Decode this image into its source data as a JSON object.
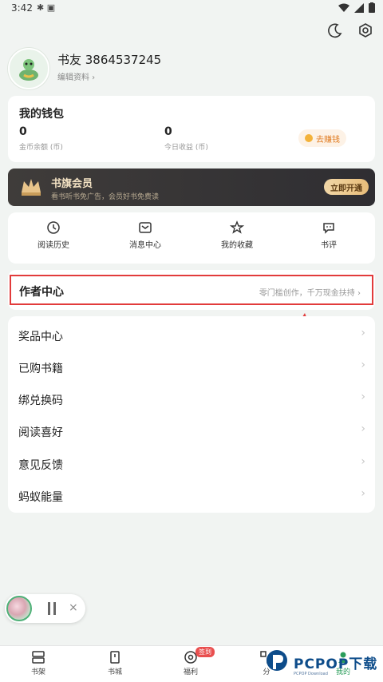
{
  "status_bar": {
    "time": "3:42"
  },
  "profile": {
    "username": "书友 3864537245",
    "edit_label": "编辑资料 ›"
  },
  "wallet": {
    "title": "我的钱包",
    "coin_balance": "0",
    "coin_label": "金币余额 (币)",
    "today_income": "0",
    "today_label": "今日收益 (币)",
    "earn_button": "去赚钱"
  },
  "vip": {
    "title": "书旗会员",
    "subtitle": "看书听书免广告，会员好书免费读",
    "button": "立即开通"
  },
  "quick_actions": [
    {
      "label": "阅读历史",
      "icon": "clock-icon"
    },
    {
      "label": "消息中心",
      "icon": "message-box-icon"
    },
    {
      "label": "我的收藏",
      "icon": "star-icon"
    },
    {
      "label": "书评",
      "icon": "chat-bubble-icon"
    }
  ],
  "author_center": {
    "title": "作者中心",
    "subtitle": "零门槛创作，千万现金扶持 ›"
  },
  "menu_items": [
    {
      "label": "奖品中心"
    },
    {
      "label": "已购书籍"
    },
    {
      "label": "绑兑换码"
    },
    {
      "label": "阅读喜好"
    },
    {
      "label": "意见反馈"
    },
    {
      "label": "蚂蚁能量"
    }
  ],
  "bottom_nav": [
    {
      "label": "书架"
    },
    {
      "label": "书城"
    },
    {
      "label": "福利"
    },
    {
      "label": "分"
    },
    {
      "label": "我的"
    }
  ],
  "badge_text": "签到",
  "watermark": {
    "text": "PCPOP下载",
    "sub": "PCPOP Download"
  },
  "colors": {
    "accent_green": "#4fb178",
    "highlight_red": "#e23b3b",
    "vip_gold": "#f4e3c4"
  }
}
